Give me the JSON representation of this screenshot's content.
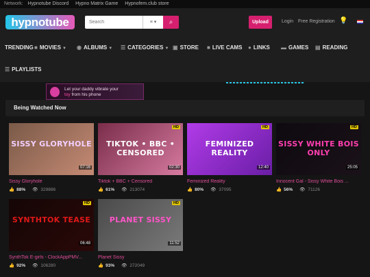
{
  "network": {
    "label": "Network:",
    "links": [
      "Hypnotube Discord",
      "Hypno Matrix Game",
      "Hypnofem.club store"
    ]
  },
  "header": {
    "logo": "hypnotube",
    "search_placeholder": "Search",
    "search_category_icon": "list-icon",
    "search_button_icon": "search-icon",
    "upload": "Upload",
    "login": "Login",
    "register": "Free Registration",
    "accent": "#d6206f"
  },
  "nav": {
    "trending": "TRENDING",
    "movies": "MOVIES",
    "albums": "ALBUMS",
    "categories": "CATEGORIES",
    "store": "STORE",
    "live_cams": "LIVE CAMS",
    "links": "LINKS",
    "games": "GAMES",
    "reading": "READING",
    "playlists": "PLAYLISTS"
  },
  "banner": {
    "line1": "Let your daddy vibrate your",
    "line2_hot": "toy",
    "line2_rest": "from his phone"
  },
  "section": {
    "title": "Being Watched Now"
  },
  "videos": [
    {
      "thumb_text": "SISSY GLORYHOLE",
      "duration": "07:16",
      "hd": "",
      "title": "Sissy Gloryhole",
      "rating": "88%",
      "views": "329886",
      "colors": [
        "#7a5a48",
        "#c58a74"
      ],
      "text_color": "#f3d0ff"
    },
    {
      "thumb_text": "TIKTOK • BBC • CENSORED",
      "duration": "02:30",
      "hd": "HD",
      "title": "Tiktok + BBC + Censored",
      "rating": "61%",
      "views": "213074",
      "colors": [
        "#7a2e4a",
        "#d67aa0"
      ],
      "text_color": "#ffffff"
    },
    {
      "thumb_text": "FEMINIZED REALITY",
      "duration": "12:40",
      "hd": "HD",
      "title": "Feminized Reality",
      "rating": "80%",
      "views": "37095",
      "colors": [
        "#b13be8",
        "#6a1ea6"
      ],
      "text_color": "#ffffff"
    },
    {
      "thumb_text": "SISSY WHITE BOIS ONLY",
      "duration": "25:05",
      "hd": "HD",
      "title": "Innocent Gal - Sissy White Bois ...",
      "rating": "56%",
      "views": "71126",
      "colors": [
        "#0e0a10",
        "#1a1218"
      ],
      "text_color": "#ff3fb0"
    },
    {
      "thumb_text": "SYNTHTOK TEASE",
      "duration": "06:48",
      "hd": "HD",
      "title": "SynthTok E-girls - ClockAppPMV...",
      "rating": "92%",
      "views": "106280",
      "colors": [
        "#150606",
        "#2a0808"
      ],
      "text_color": "#e01818"
    },
    {
      "thumb_text": "PLANET SISSY",
      "duration": "11:52",
      "hd": "HD",
      "title": "Planet Sissy",
      "rating": "93%",
      "views": "272049",
      "colors": [
        "#4a4a4a",
        "#7a7a7a"
      ],
      "text_color": "#ff55c8"
    }
  ]
}
